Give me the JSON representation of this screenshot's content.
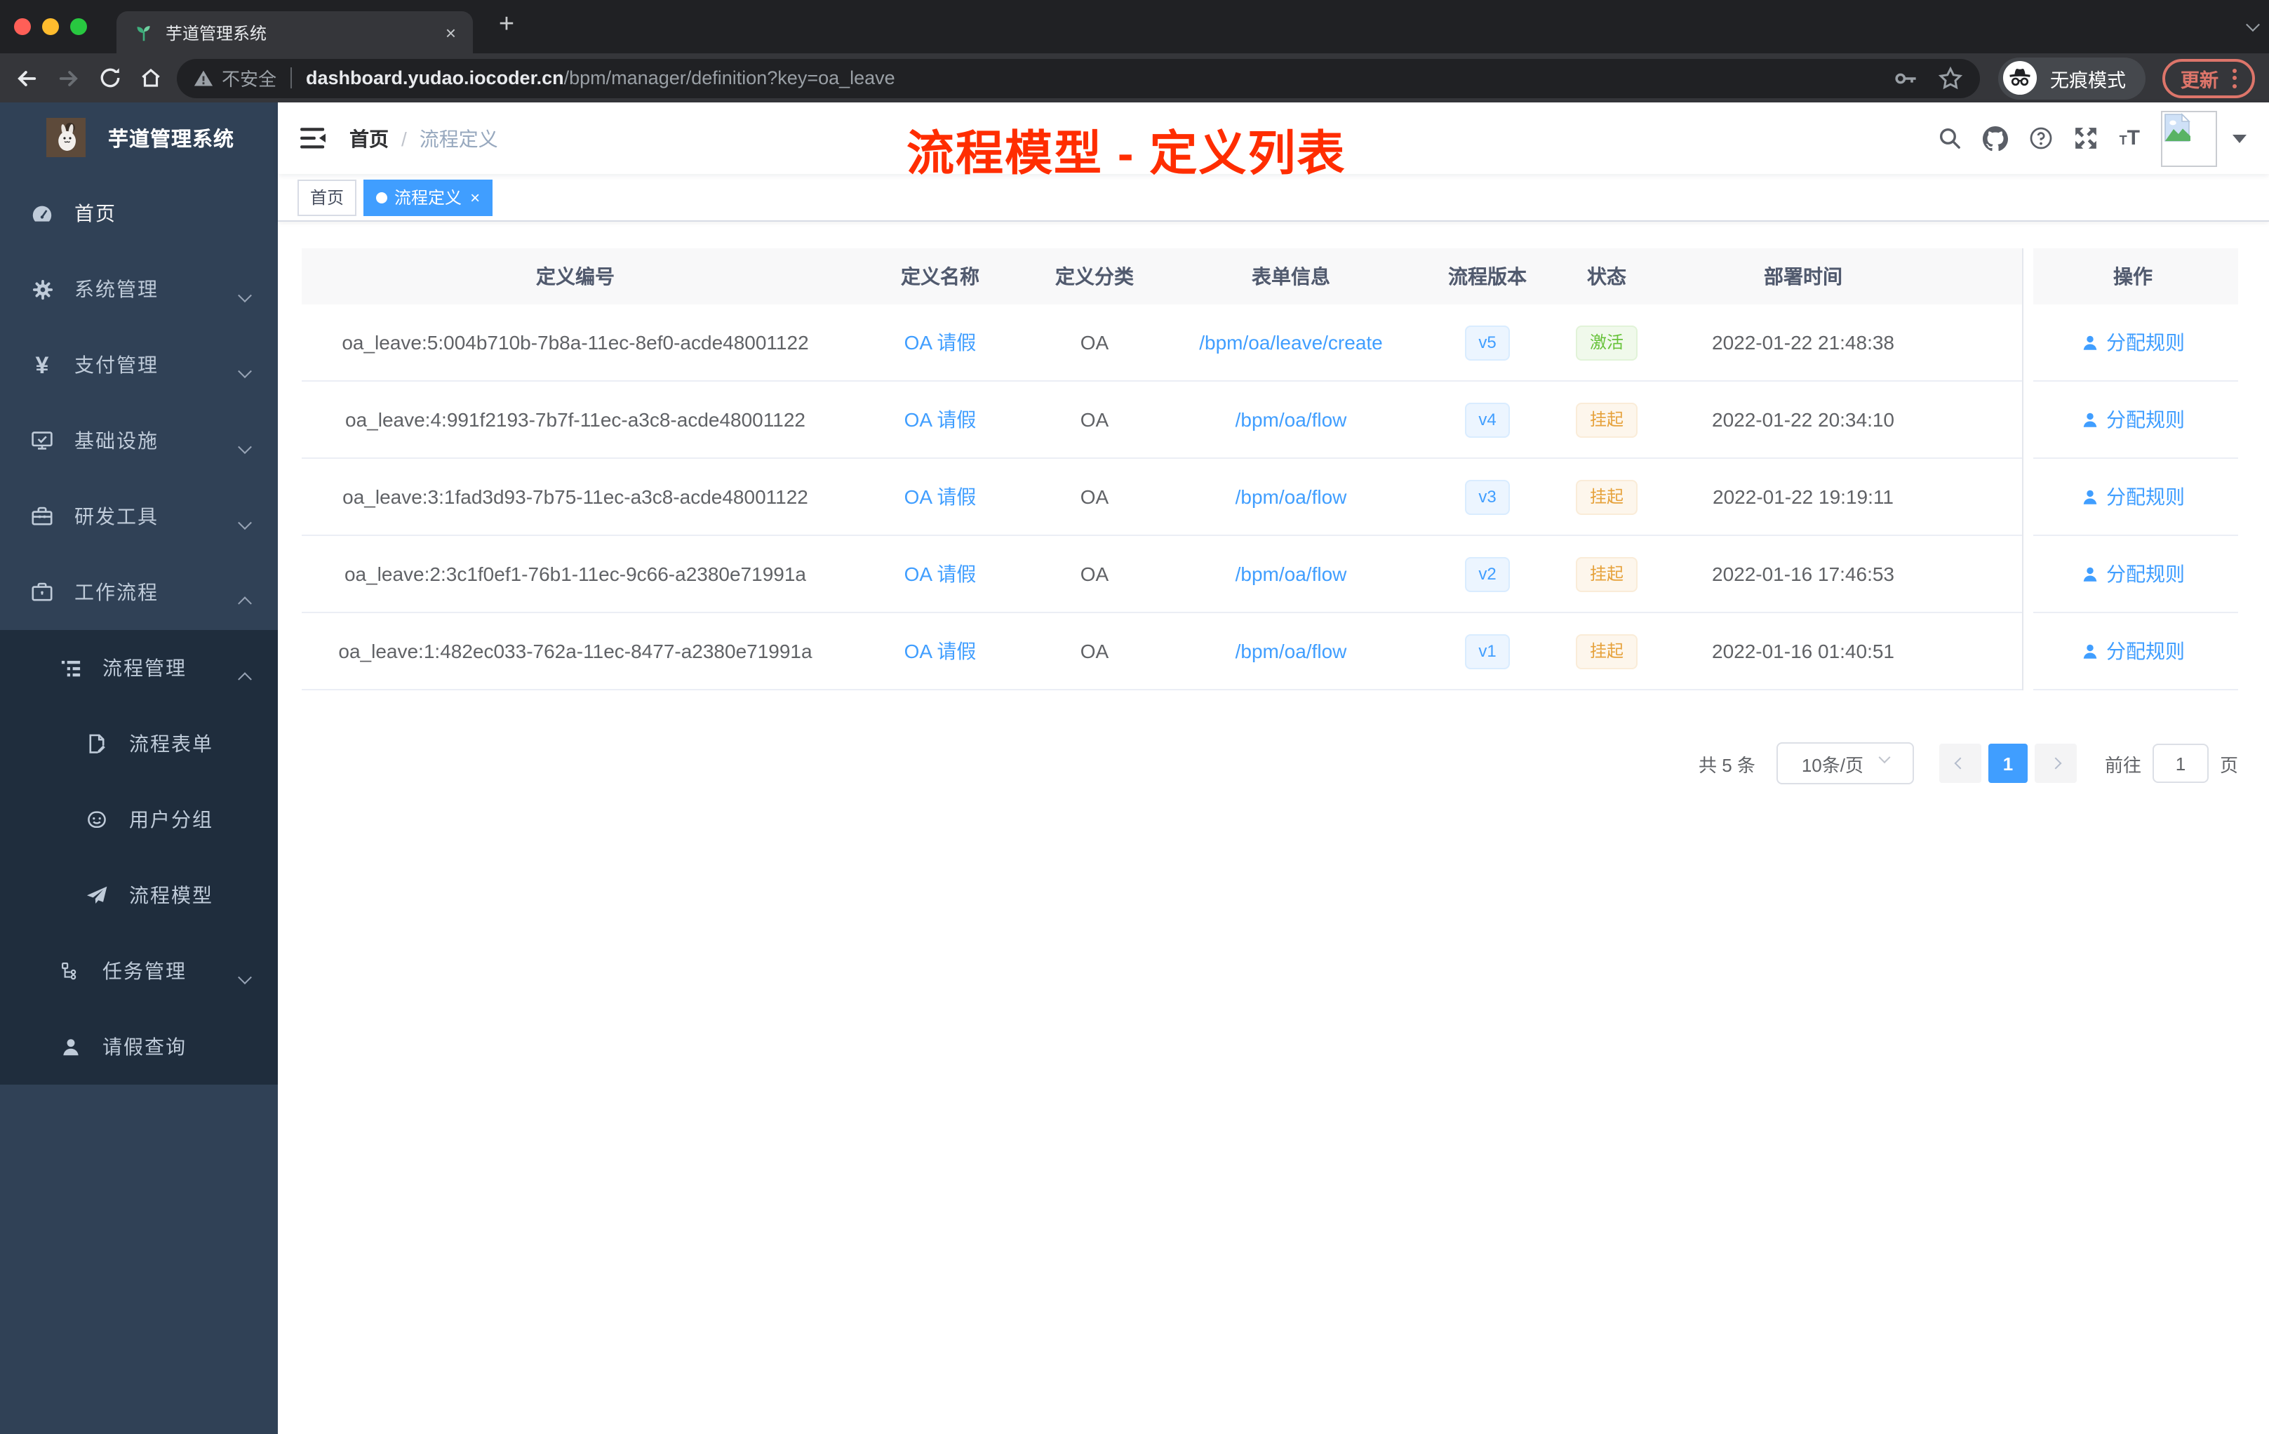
{
  "browser": {
    "tab": {
      "title": "芋道管理系统",
      "close_glyph": "×",
      "new_tab_glyph": "+"
    },
    "address": {
      "security_label": "不安全",
      "host": "dashboard.yudao.iocoder.cn",
      "path": "/bpm/manager/definition?key=oa_leave"
    },
    "incognito_label": "无痕模式",
    "update_label": "更新"
  },
  "sidebar": {
    "logo_title": "芋道管理系统",
    "items": [
      {
        "label": "首页",
        "icon": "dashboard",
        "level": 0,
        "bright": true
      },
      {
        "label": "系统管理",
        "icon": "gear",
        "level": 0,
        "chevron": "down"
      },
      {
        "label": "支付管理",
        "icon": "yen",
        "level": 0,
        "chevron": "down"
      },
      {
        "label": "基础设施",
        "icon": "monitor",
        "level": 0,
        "chevron": "down"
      },
      {
        "label": "研发工具",
        "icon": "toolbox",
        "level": 0,
        "chevron": "down"
      },
      {
        "label": "工作流程",
        "icon": "briefcase",
        "level": 0,
        "chevron": "up"
      },
      {
        "label": "流程管理",
        "icon": "tree-list",
        "level": 1,
        "chevron": "up",
        "dark": true
      },
      {
        "label": "流程表单",
        "icon": "form-edit",
        "level": 2,
        "dark": true
      },
      {
        "label": "用户分组",
        "icon": "face",
        "level": 2,
        "dark": true
      },
      {
        "label": "流程模型",
        "icon": "paper-plane",
        "level": 2,
        "dark": true
      },
      {
        "label": "任务管理",
        "icon": "org-tree",
        "level": 1,
        "chevron": "down",
        "dark": true
      },
      {
        "label": "请假查询",
        "icon": "person",
        "level": 1,
        "dark": true
      }
    ]
  },
  "header": {
    "breadcrumb": [
      "首页",
      "流程定义"
    ],
    "separator": "/",
    "annotation": "流程模型 - 定义列表"
  },
  "tags": [
    {
      "label": "首页",
      "active": false,
      "closable": false
    },
    {
      "label": "流程定义",
      "active": true,
      "closable": true
    }
  ],
  "table": {
    "columns": [
      "定义编号",
      "定义名称",
      "定义分类",
      "表单信息",
      "流程版本",
      "状态",
      "部署时间",
      "操作"
    ],
    "action_label": "分配规则",
    "rows": [
      {
        "id": "oa_leave:5:004b710b-7b8a-11ec-8ef0-acde48001122",
        "name": "OA 请假",
        "category": "OA",
        "form": "/bpm/oa/leave/create",
        "version": "v5",
        "status": "激活",
        "status_type": "success",
        "deploy_time": "2022-01-22 21:48:38"
      },
      {
        "id": "oa_leave:4:991f2193-7b7f-11ec-a3c8-acde48001122",
        "name": "OA 请假",
        "category": "OA",
        "form": "/bpm/oa/flow",
        "version": "v4",
        "status": "挂起",
        "status_type": "warning",
        "deploy_time": "2022-01-22 20:34:10"
      },
      {
        "id": "oa_leave:3:1fad3d93-7b75-11ec-a3c8-acde48001122",
        "name": "OA 请假",
        "category": "OA",
        "form": "/bpm/oa/flow",
        "version": "v3",
        "status": "挂起",
        "status_type": "warning",
        "deploy_time": "2022-01-22 19:19:11"
      },
      {
        "id": "oa_leave:2:3c1f0ef1-76b1-11ec-9c66-a2380e71991a",
        "name": "OA 请假",
        "category": "OA",
        "form": "/bpm/oa/flow",
        "version": "v2",
        "status": "挂起",
        "status_type": "warning",
        "deploy_time": "2022-01-16 17:46:53"
      },
      {
        "id": "oa_leave:1:482ec033-762a-11ec-8477-a2380e71991a",
        "name": "OA 请假",
        "category": "OA",
        "form": "/bpm/oa/flow",
        "version": "v1",
        "status": "挂起",
        "status_type": "warning",
        "deploy_time": "2022-01-16 01:40:51"
      }
    ]
  },
  "pagination": {
    "total": "共 5 条",
    "page_size": "10条/页",
    "current_page": "1",
    "goto_label": "前往",
    "unit_label": "页"
  },
  "colors": {
    "accent": "#409eff",
    "success": "#67c23a",
    "warning": "#e6a23c",
    "annotation_red": "#ff2d00",
    "sidebar_bg": "#304156",
    "submenu_bg": "#1f2d3d",
    "sidebar_text": "#bfcbd9"
  }
}
